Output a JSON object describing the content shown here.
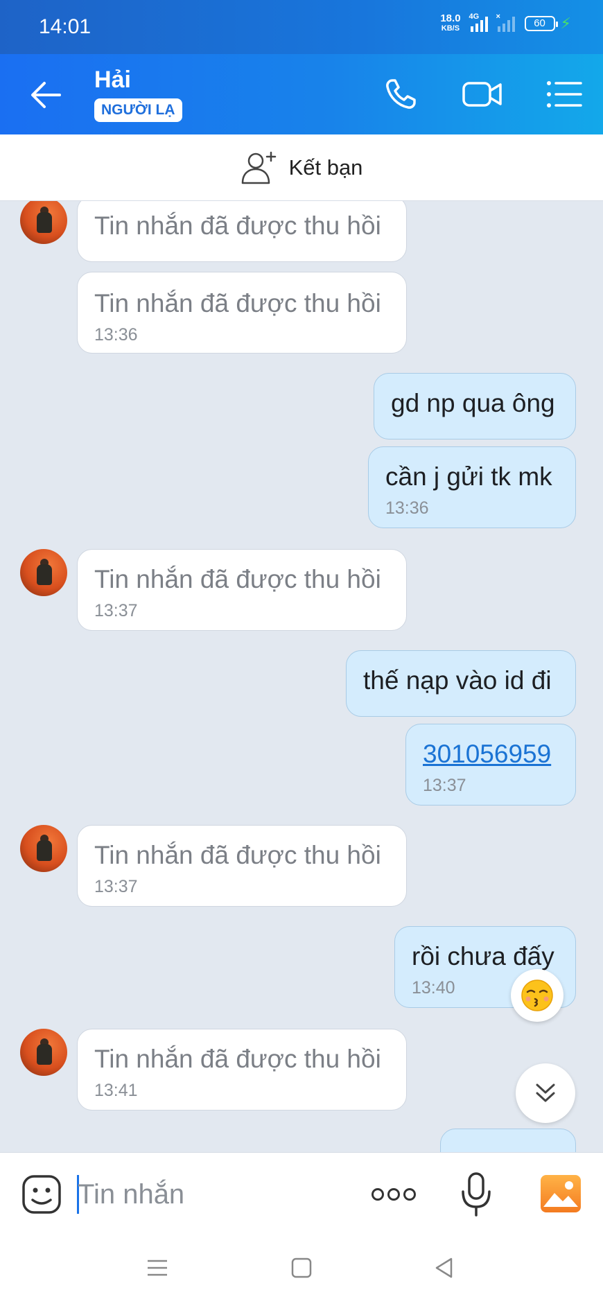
{
  "status_bar": {
    "time": "14:01",
    "net_speed_value": "18.0",
    "net_speed_unit": "KB/S",
    "net_type": "4G",
    "sim2_tag": "×",
    "battery": "60"
  },
  "header": {
    "name": "Hải",
    "badge": "NGƯỜI LẠ"
  },
  "add_friend": {
    "label": "Kết bạn"
  },
  "messages": [
    {
      "dir": "in",
      "text": "Tin nhắn đã được thu hồi",
      "time": ""
    },
    {
      "dir": "in",
      "text": "Tin nhắn đã được thu hồi",
      "time": "13:36"
    },
    {
      "dir": "out",
      "text": "gd np qua ông",
      "time": ""
    },
    {
      "dir": "out",
      "text": "cần j gửi tk mk",
      "time": "13:36"
    },
    {
      "dir": "in",
      "text": "Tin nhắn đã được thu hồi",
      "time": "13:37"
    },
    {
      "dir": "out",
      "text": "thế nạp vào id đi",
      "time": ""
    },
    {
      "dir": "out",
      "text": "301056959",
      "time": "13:37",
      "is_link": true
    },
    {
      "dir": "in",
      "text": "Tin nhắn đã được thu hồi",
      "time": "13:37"
    },
    {
      "dir": "out",
      "text": "rồi chưa đấy",
      "time": "13:40"
    },
    {
      "dir": "in",
      "text": "Tin nhắn đã được thu hồi",
      "time": "13:41"
    }
  ],
  "input": {
    "placeholder": "Tin nhắn"
  },
  "colors": {
    "header_start": "#1a6ff2",
    "header_end": "#13a8ea",
    "out_bubble": "#d4ecfd",
    "chat_bg": "#e2e8f0",
    "link": "#1a73d4"
  }
}
